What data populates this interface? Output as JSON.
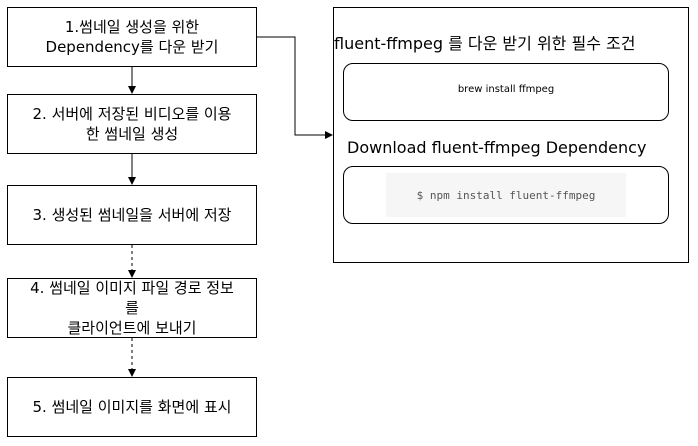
{
  "steps": [
    "1.썸네일 생성을 위한\nDependency를 다운 받기",
    "2. 서버에 저장된 비디오를 이용\n한 썸네일 생성",
    "3. 생성된 썸네일을 서버에 저장",
    "4. 썸네일 이미지 파일 경로 정보\n를\n클라이언트에 보내기",
    "5. 썸네일 이미지를 화면에 표시"
  ],
  "panel": {
    "title": "fluent-ffmpeg 를 다운 받기 위한 필수 조건",
    "brew_command": "brew install ffmpeg",
    "subtitle": "Download fluent-ffmpeg Dependency",
    "npm_command": "$ npm install fluent-ffmpeg"
  },
  "colors": {
    "line": "#000000",
    "code_background": "#f6f6f6",
    "code_text": "#555555"
  }
}
